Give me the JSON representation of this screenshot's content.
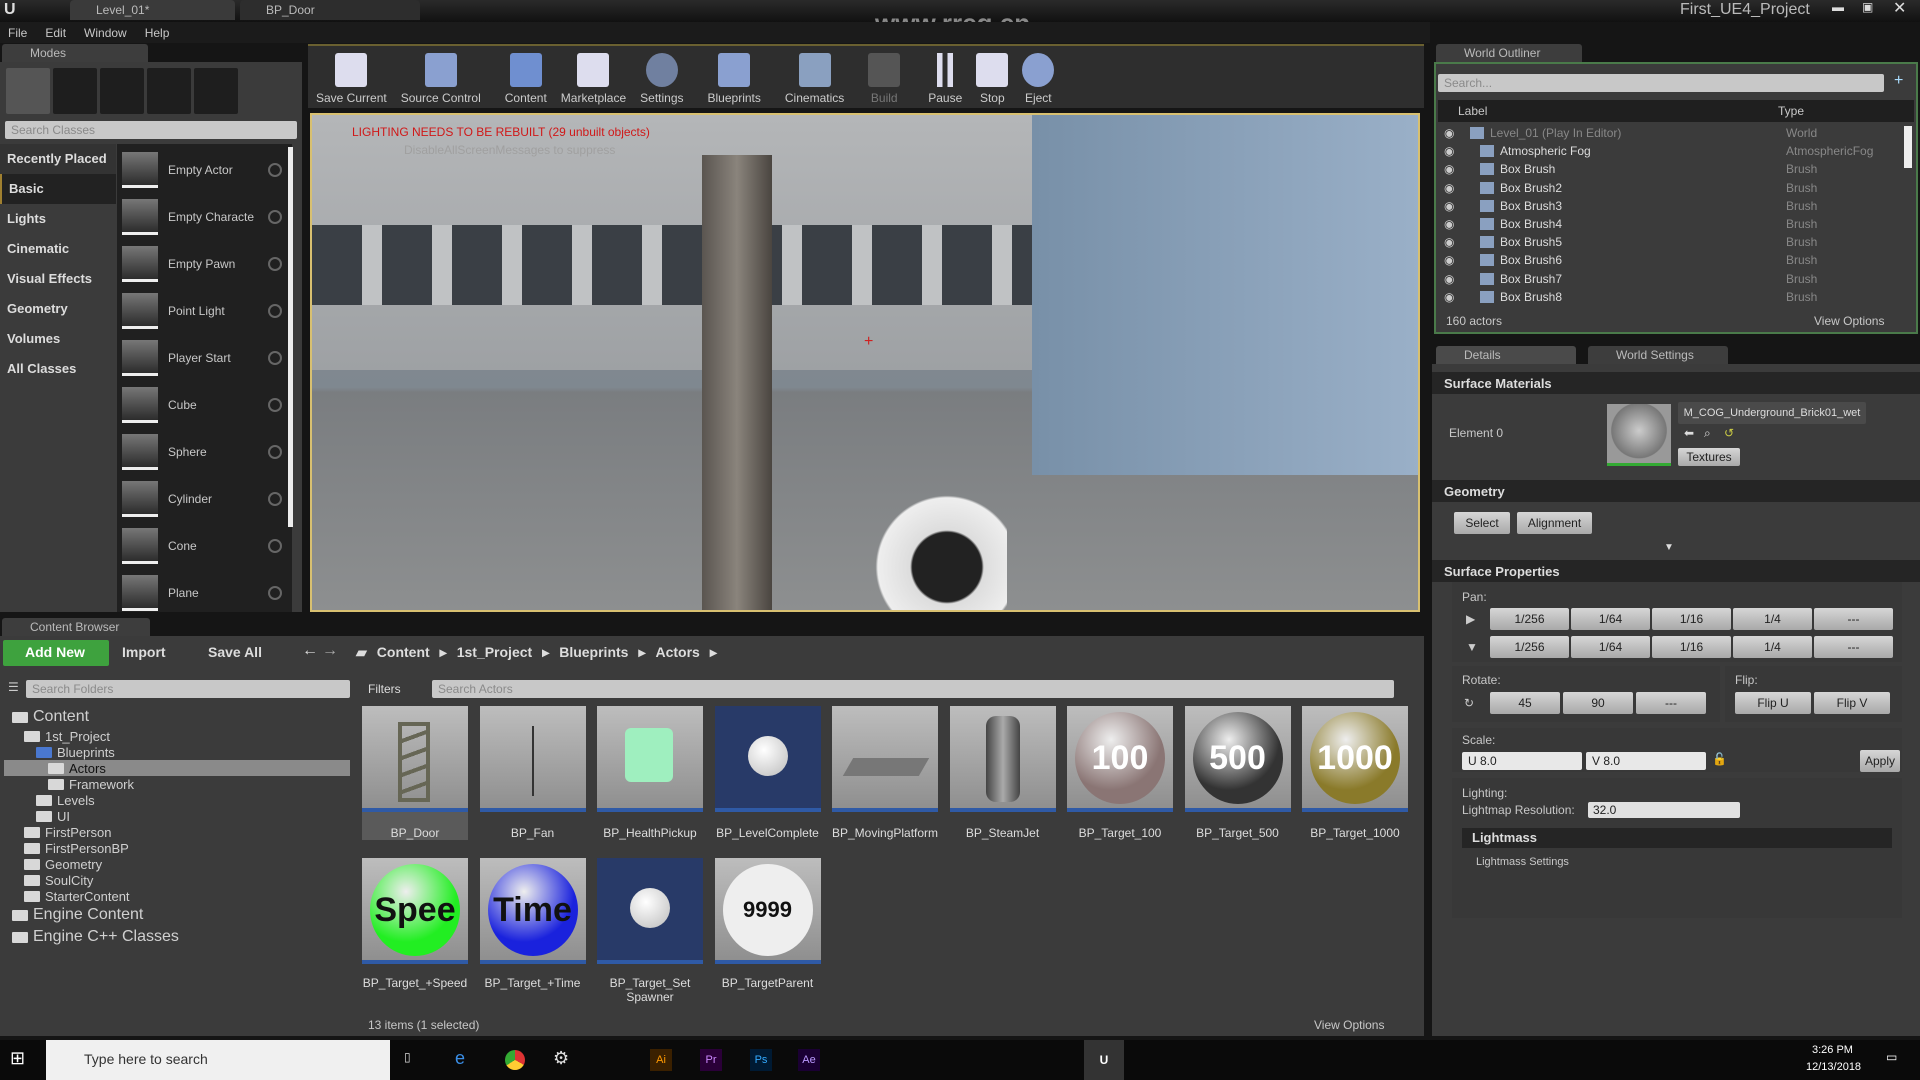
{
  "window": {
    "tabs": [
      "Level_01*",
      "BP_Door"
    ],
    "project": "First_UE4_Project",
    "watermark": "www.rrcg.cn"
  },
  "menu": [
    "File",
    "Edit",
    "Window",
    "Help"
  ],
  "modes": {
    "tab": "Modes",
    "search_placeholder": "Search Classes",
    "categories": [
      "Recently Placed",
      "Basic",
      "Lights",
      "Cinematic",
      "Visual Effects",
      "Geometry",
      "Volumes",
      "All Classes"
    ],
    "selected_category": "Basic",
    "items": [
      "Empty Actor",
      "Empty Characte",
      "Empty Pawn",
      "Point Light",
      "Player Start",
      "Cube",
      "Sphere",
      "Cylinder",
      "Cone",
      "Plane"
    ]
  },
  "toolbar": [
    "Save Current",
    "Source Control",
    "Content",
    "Marketplace",
    "Settings",
    "Blueprints",
    "Cinematics",
    "Build",
    "Pause",
    "Stop",
    "Eject"
  ],
  "viewport": {
    "warning": "LIGHTING NEEDS TO BE REBUILT (29 unbuilt objects)",
    "hint": "DisableAllScreenMessages to suppress"
  },
  "outliner": {
    "tab": "World Outliner",
    "search_placeholder": "Search...",
    "col_label": "Label",
    "col_type": "Type",
    "rows": [
      {
        "label": "Level_01 (Play In Editor)",
        "type": "World"
      },
      {
        "label": "Atmospheric Fog",
        "type": "AtmosphericFog"
      },
      {
        "label": "Box Brush",
        "type": "Brush"
      },
      {
        "label": "Box Brush2",
        "type": "Brush"
      },
      {
        "label": "Box Brush3",
        "type": "Brush"
      },
      {
        "label": "Box Brush4",
        "type": "Brush"
      },
      {
        "label": "Box Brush5",
        "type": "Brush"
      },
      {
        "label": "Box Brush6",
        "type": "Brush"
      },
      {
        "label": "Box Brush7",
        "type": "Brush"
      },
      {
        "label": "Box Brush8",
        "type": "Brush"
      }
    ],
    "count": "160 actors",
    "view_options": "View Options"
  },
  "details": {
    "tabs": [
      "Details",
      "World Settings"
    ],
    "surface_materials": "Surface Materials",
    "element": "Element 0",
    "material": "M_COG_Underground_Brick01_wet",
    "textures": "Textures",
    "geometry": "Geometry",
    "select": "Select",
    "alignment": "Alignment",
    "surface_properties": "Surface Properties",
    "pan": "Pan:",
    "pan_values": [
      "1/256",
      "1/64",
      "1/16",
      "1/4",
      "---"
    ],
    "rotate": "Rotate:",
    "rotate_values": [
      "45",
      "90",
      "---"
    ],
    "flip": "Flip:",
    "flip_u": "Flip U",
    "flip_v": "Flip V",
    "scale": "Scale:",
    "scale_u": "U  8.0",
    "scale_v": "V  8.0",
    "apply": "Apply",
    "lighting": "Lighting:",
    "lightmap_label": "Lightmap Resolution:",
    "lightmap_value": "32.0",
    "lightmass": "Lightmass",
    "lightmass_settings": "Lightmass Settings"
  },
  "content_browser": {
    "tab": "Content Browser",
    "add_new": "Add New",
    "import": "Import",
    "save_all": "Save All",
    "breadcrumb": [
      "Content",
      "1st_Project",
      "Blueprints",
      "Actors"
    ],
    "folder_search": "Search Folders",
    "filters": "Filters",
    "asset_search": "Search Actors",
    "folders": [
      {
        "name": "Content",
        "level": 0
      },
      {
        "name": "1st_Project",
        "level": 1
      },
      {
        "name": "Blueprints",
        "level": 2
      },
      {
        "name": "Actors",
        "level": 3,
        "selected": true
      },
      {
        "name": "Framework",
        "level": 3
      },
      {
        "name": "Levels",
        "level": 2
      },
      {
        "name": "UI",
        "level": 2
      },
      {
        "name": "FirstPerson",
        "level": 1
      },
      {
        "name": "FirstPersonBP",
        "level": 1
      },
      {
        "name": "Geometry",
        "level": 1
      },
      {
        "name": "SoulCity",
        "level": 1
      },
      {
        "name": "StarterContent",
        "level": 1
      },
      {
        "name": "Engine Content",
        "level": 0
      },
      {
        "name": "Engine C++ Classes",
        "level": 0
      }
    ],
    "assets": [
      {
        "name": "BP_Door",
        "thumb": "door"
      },
      {
        "name": "BP_Fan",
        "thumb": "fan"
      },
      {
        "name": "BP_HealthPickup",
        "thumb": "health"
      },
      {
        "name": "BP_LevelComplete",
        "thumb": "sphere-blue"
      },
      {
        "name": "BP_MovingPlatform",
        "thumb": "platform"
      },
      {
        "name": "BP_SteamJet",
        "thumb": "steam"
      },
      {
        "name": "BP_Target_100",
        "thumb": "target",
        "text": "100",
        "color": "#8a7574"
      },
      {
        "name": "BP_Target_500",
        "thumb": "target",
        "text": "500",
        "color": "#333"
      },
      {
        "name": "BP_Target_1000",
        "thumb": "target",
        "text": "1000",
        "color": "#8a7a2a"
      },
      {
        "name": "BP_Target_+Speed",
        "thumb": "disc",
        "text": "Spee",
        "color": "#22ee22"
      },
      {
        "name": "BP_Target_+Time",
        "thumb": "disc",
        "text": "Time",
        "color": "#1a22dd"
      },
      {
        "name": "BP_Target_Set Spawner",
        "thumb": "sphere-blue"
      },
      {
        "name": "BP_TargetParent",
        "thumb": "egg",
        "text": "9999",
        "color": "#eee"
      }
    ],
    "status": "13 items (1 selected)",
    "view_options": "View Options"
  },
  "taskbar": {
    "search_placeholder": "Type here to search",
    "time": "3:26 PM",
    "date": "12/13/2018"
  }
}
